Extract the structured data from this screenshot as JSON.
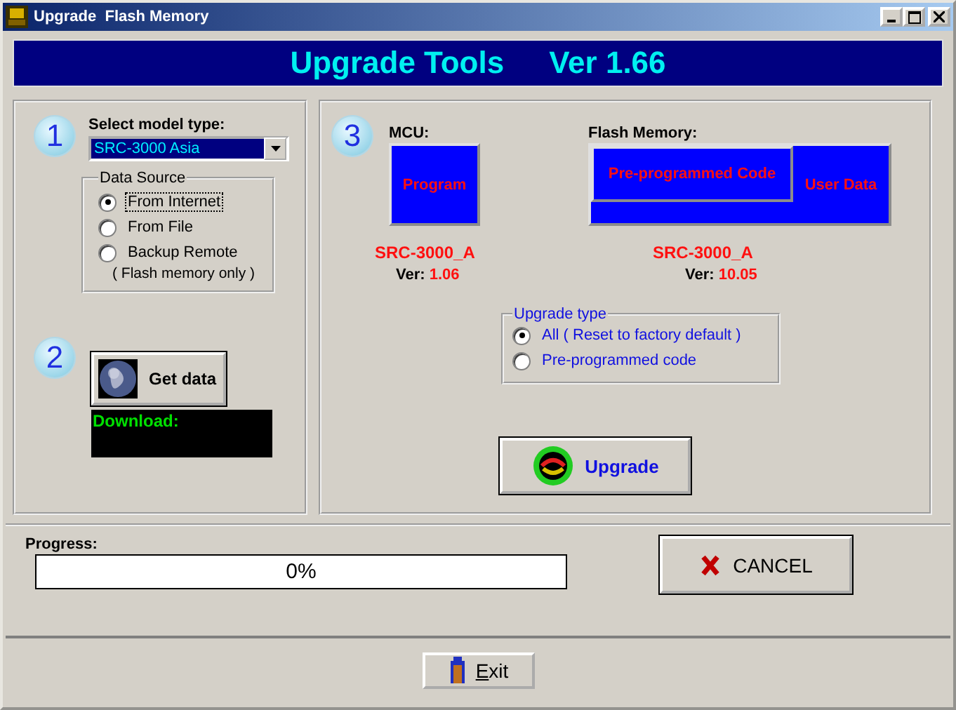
{
  "window": {
    "title": "Upgrade  Flash Memory"
  },
  "banner": {
    "title": "Upgrade Tools",
    "version": "Ver 1.66"
  },
  "step1": {
    "badge": "1",
    "label": "Select model type:",
    "model": "SRC-3000 Asia",
    "data_source": {
      "legend": "Data Source",
      "options": [
        {
          "label": "From Internet",
          "selected": true
        },
        {
          "label": "From File",
          "selected": false
        },
        {
          "label": "Backup Remote",
          "note": "( Flash memory only )",
          "selected": false
        }
      ]
    }
  },
  "step2": {
    "badge": "2",
    "button": "Get data",
    "download_label": "Download:"
  },
  "step3": {
    "badge": "3",
    "mcu": {
      "label": "MCU:",
      "block": "Program",
      "model": "SRC-3000_A",
      "ver_label": "Ver:",
      "ver": "1.06"
    },
    "flash": {
      "label": "Flash Memory:",
      "block_code": "Pre-programmed Code",
      "block_user": "User Data",
      "model": "SRC-3000_A",
      "ver_label": "Ver:",
      "ver": "10.05"
    },
    "upgrade_type": {
      "legend": "Upgrade type",
      "options": [
        {
          "label": "All ( Reset to factory default )",
          "selected": true
        },
        {
          "label": "Pre-programmed code",
          "selected": false
        }
      ]
    },
    "button": "Upgrade"
  },
  "progress": {
    "label": "Progress:",
    "level": 0,
    "reading": "0%"
  },
  "cancel": "CANCEL",
  "exit": "Exit"
}
